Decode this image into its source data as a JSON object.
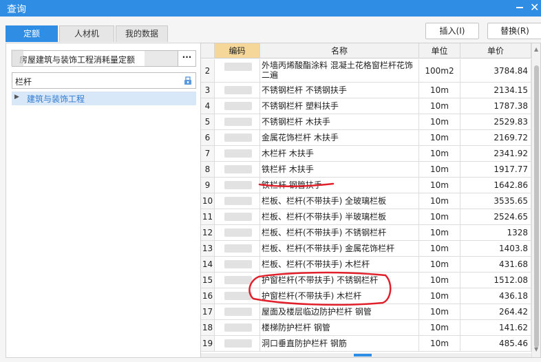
{
  "window": {
    "title": "查询",
    "minimize_icon": "minimize-icon",
    "close_label": "✕"
  },
  "tabs": [
    {
      "label": "定额",
      "active": true
    },
    {
      "label": "人材机",
      "active": false
    },
    {
      "label": "我的数据",
      "active": false
    }
  ],
  "actions": {
    "insert": "插入(I)",
    "replace": "替换(R)"
  },
  "left": {
    "library": "房屋建筑与装饰工程消耗量定额",
    "more": "···",
    "search_value": "栏杆",
    "tree_root": "建筑与装饰工程"
  },
  "grid": {
    "headers": {
      "code": "编码",
      "name": "名称",
      "unit": "单位",
      "price": "单价"
    },
    "rows": [
      {
        "no": "2",
        "name": "外墙丙烯酸酯涂料 混凝土花格窗栏杆花饰二遍",
        "unit": "100m2",
        "price": "3784.84"
      },
      {
        "no": "3",
        "name": "不锈钢栏杆 不锈钢扶手",
        "unit": "10m",
        "price": "2134.15"
      },
      {
        "no": "4",
        "name": "不锈钢栏杆 塑料扶手",
        "unit": "10m",
        "price": "1787.38"
      },
      {
        "no": "5",
        "name": "不锈钢栏杆 木扶手",
        "unit": "10m",
        "price": "2529.83"
      },
      {
        "no": "6",
        "name": "金属花饰栏杆 木扶手",
        "unit": "10m",
        "price": "2169.72"
      },
      {
        "no": "7",
        "name": "木栏杆 木扶手",
        "unit": "10m",
        "price": "2341.92"
      },
      {
        "no": "8",
        "name": "铁栏杆 木扶手",
        "unit": "10m",
        "price": "1917.77"
      },
      {
        "no": "9",
        "name": "铁栏杆 钢管扶手",
        "unit": "10m",
        "price": "1642.86"
      },
      {
        "no": "10",
        "name": "栏板、栏杆(不带扶手) 全玻璃栏板",
        "unit": "10m",
        "price": "3535.65"
      },
      {
        "no": "11",
        "name": "栏板、栏杆(不带扶手) 半玻璃栏板",
        "unit": "10m",
        "price": "2524.65"
      },
      {
        "no": "12",
        "name": "栏板、栏杆(不带扶手) 不锈钢栏杆",
        "unit": "10m",
        "price": "1328"
      },
      {
        "no": "13",
        "name": "栏板、栏杆(不带扶手) 金属花饰栏杆",
        "unit": "10m",
        "price": "1403.8"
      },
      {
        "no": "14",
        "name": "栏板、栏杆(不带扶手) 木栏杆",
        "unit": "10m",
        "price": "431.68"
      },
      {
        "no": "15",
        "name": "护窗栏杆(不带扶手) 不锈钢栏杆",
        "unit": "10m",
        "price": "1512.08"
      },
      {
        "no": "16",
        "name": "护窗栏杆(不带扶手) 木栏杆",
        "unit": "10m",
        "price": "436.18"
      },
      {
        "no": "17",
        "name": "屋面及楼层临边防护栏杆 钢管",
        "unit": "10m",
        "price": "264.42"
      },
      {
        "no": "18",
        "name": "楼梯防护栏杆 钢管",
        "unit": "10m",
        "price": "141.62"
      },
      {
        "no": "19",
        "name": "洞口垂直防护栏杆 钢筋",
        "unit": "10m",
        "price": "485.46"
      }
    ]
  },
  "colors": {
    "accent": "#2f8de4",
    "annotation": "#e0202a",
    "code_header": "#f6d79a"
  }
}
